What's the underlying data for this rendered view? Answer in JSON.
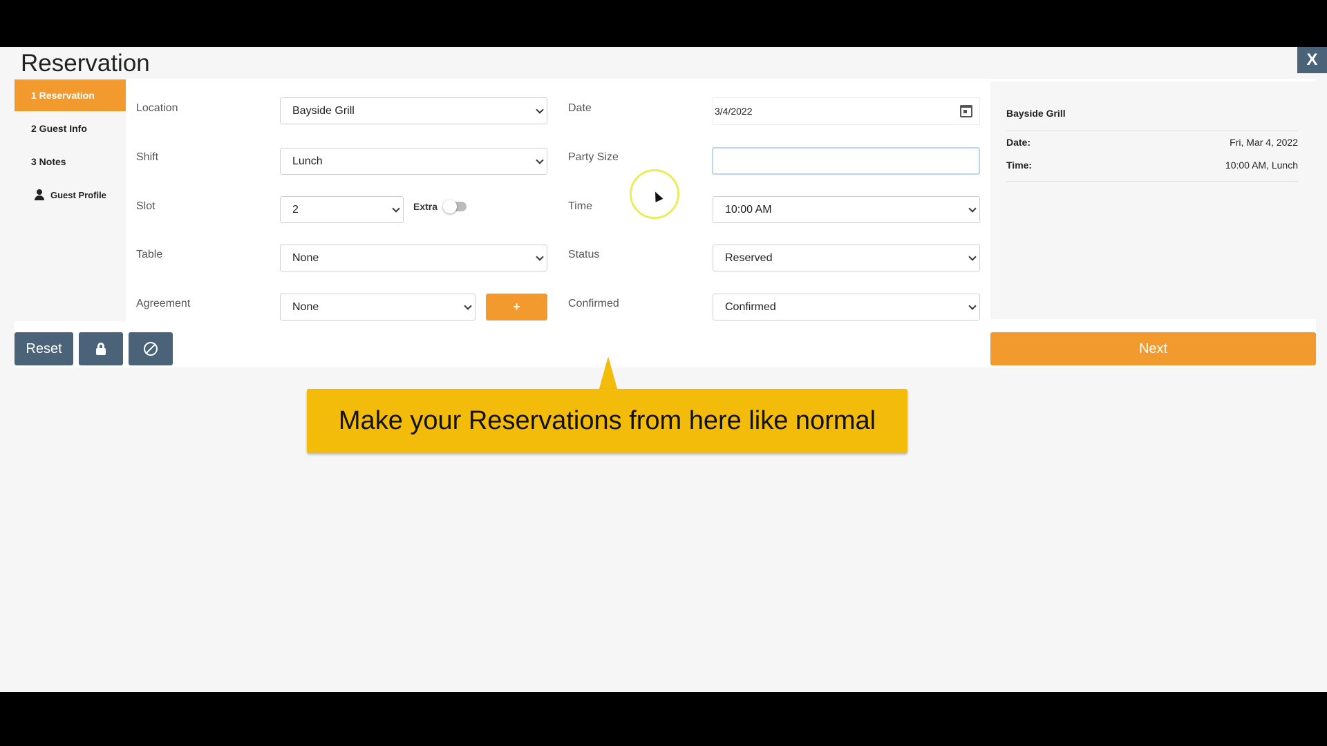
{
  "window": {
    "title": "Reservation",
    "close_label": "X"
  },
  "nav": {
    "items": [
      {
        "label": "1 Reservation",
        "active": true
      },
      {
        "label": "2 Guest Info"
      },
      {
        "label": "3 Notes"
      },
      {
        "label": "Guest Profile",
        "icon": "person-icon"
      }
    ]
  },
  "form": {
    "location": {
      "label": "Location",
      "value": "Bayside Grill"
    },
    "shift": {
      "label": "Shift",
      "value": "Lunch"
    },
    "slot": {
      "label": "Slot",
      "value": "2"
    },
    "extra": {
      "label": "Extra",
      "on": false
    },
    "table": {
      "label": "Table",
      "value": "None"
    },
    "agreement": {
      "label": "Agreement",
      "value": "None",
      "add_label": "+"
    },
    "date": {
      "label": "Date",
      "value": "3/4/2022",
      "icon": "calendar-icon"
    },
    "party_size": {
      "label": "Party Size",
      "value": ""
    },
    "time": {
      "label": "Time",
      "value": "10:00 AM"
    },
    "status": {
      "label": "Status",
      "value": "Reserved"
    },
    "confirmed": {
      "label": "Confirmed",
      "value": "Confirmed"
    }
  },
  "summary": {
    "title": "Bayside Grill",
    "date_label": "Date:",
    "date_value": "Fri, Mar 4, 2022",
    "time_label": "Time:",
    "time_value": "10:00 AM, Lunch"
  },
  "actions": {
    "reset_label": "Reset",
    "lock_icon": "lock-icon",
    "cancel_icon": "ban-icon",
    "next_label": "Next"
  },
  "callout": {
    "text": "Make your Reservations from here like normal"
  },
  "colors": {
    "accent": "#f29a2e",
    "dark_button": "#4a6378",
    "callout": "#f3bb0a"
  }
}
